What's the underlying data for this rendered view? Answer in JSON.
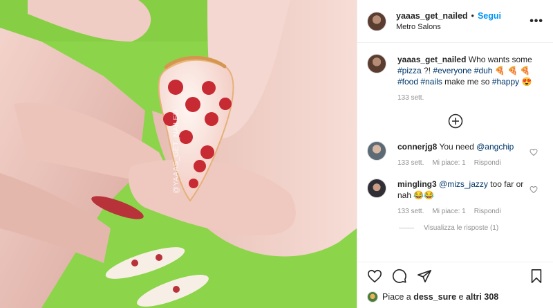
{
  "post": {
    "username": "yaaas_get_nailed",
    "dot": "•",
    "follow_label": "Segui",
    "location": "Metro Salons",
    "more_label": "•••",
    "image_watermark": "@YAAAS_GET_NAILED"
  },
  "caption": {
    "username": "yaaas_get_nailed",
    "text_1": "Who wants some",
    "tags_line": [
      "#pizza",
      "?!",
      "#everyone",
      "#duh",
      "🍕 🍕 🍕"
    ],
    "tags_line2": [
      "#food",
      "#nails",
      "make me so",
      "#happy",
      "😍"
    ],
    "time": "133 sett."
  },
  "comments": [
    {
      "username": "connerjg8",
      "text": "You need",
      "mention": "@angchip",
      "time": "133 sett.",
      "likes": "Mi piace: 1",
      "reply": "Rispondi"
    },
    {
      "username": "mingling3",
      "mention": "@mizs_jazzy",
      "text": "too far or nah 😂😂",
      "time": "133 sett.",
      "likes": "Mi piace: 1",
      "reply": "Rispondi"
    }
  ],
  "view_replies": "Visualizza le risposte (1)",
  "likes_bar": {
    "prefix": "Piace a",
    "user": "dess_sure",
    "middle": "e",
    "others": "altri 308"
  },
  "colors": {
    "background_green": "#8cd44a",
    "link_blue": "#0095f6",
    "tag_navy": "#00376b",
    "muted_gray": "#8e8e8e"
  },
  "icons": [
    "heart-icon",
    "comment-icon",
    "share-icon",
    "bookmark-icon",
    "add-circle-icon",
    "more-icon"
  ]
}
